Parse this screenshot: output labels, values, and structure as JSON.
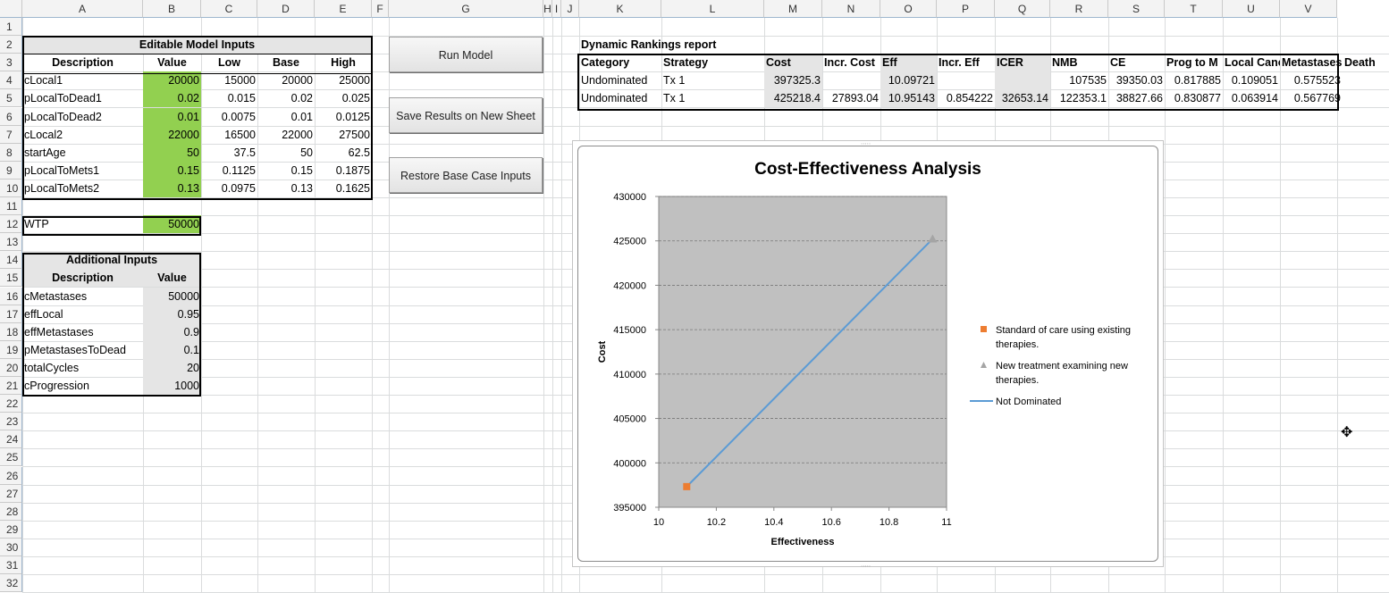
{
  "columns": [
    "A",
    "B",
    "C",
    "D",
    "E",
    "F",
    "G",
    "H",
    "I",
    "J",
    "K",
    "L",
    "M",
    "N",
    "O",
    "P",
    "Q",
    "R",
    "S",
    "T",
    "U",
    "V"
  ],
  "rows": [
    "1",
    "2",
    "3",
    "4",
    "5",
    "6",
    "7",
    "8",
    "9",
    "10",
    "11",
    "12",
    "13",
    "14",
    "15",
    "16",
    "17",
    "18",
    "19",
    "20",
    "21",
    "22",
    "23",
    "24",
    "25",
    "26",
    "27",
    "28",
    "29",
    "30",
    "31",
    "32"
  ],
  "inputs": {
    "title": "Editable Model Inputs",
    "headers": [
      "Description",
      "Value",
      "Low",
      "Base",
      "High"
    ],
    "rows": [
      [
        "cLocal1",
        "20000",
        "15000",
        "20000",
        "25000"
      ],
      [
        "pLocalToDead1",
        "0.02",
        "0.015",
        "0.02",
        "0.025"
      ],
      [
        "pLocalToDead2",
        "0.01",
        "0.0075",
        "0.01",
        "0.0125"
      ],
      [
        "cLocal2",
        "22000",
        "16500",
        "22000",
        "27500"
      ],
      [
        "startAge",
        "50",
        "37.5",
        "50",
        "62.5"
      ],
      [
        "pLocalToMets1",
        "0.15",
        "0.1125",
        "0.15",
        "0.1875"
      ],
      [
        "pLocalToMets2",
        "0.13",
        "0.0975",
        "0.13",
        "0.1625"
      ]
    ]
  },
  "wtp": {
    "label": "WTP",
    "value": "50000"
  },
  "additional": {
    "title": "Additional Inputs",
    "headers": [
      "Description",
      "Value"
    ],
    "rows": [
      [
        "cMetastases",
        "50000"
      ],
      [
        "effLocal",
        "0.95"
      ],
      [
        "effMetastases",
        "0.9"
      ],
      [
        "pMetastasesToDead",
        "0.1"
      ],
      [
        "totalCycles",
        "20"
      ],
      [
        "cProgression",
        "1000"
      ]
    ]
  },
  "buttons": {
    "run": "Run Model",
    "save": "Save Results on New Sheet",
    "restore": "Restore Base Case Inputs"
  },
  "report": {
    "title": "Dynamic Rankings report",
    "headers": [
      "Category",
      "Strategy",
      "Cost",
      "Incr. Cost",
      "Eff",
      "Incr. Eff",
      "ICER",
      "NMB",
      "CE",
      "Prog to M",
      "Local Canc",
      "Metastases",
      "Death"
    ],
    "rows": [
      [
        "Undominated",
        "Tx 1",
        "397325.3",
        "",
        "10.09721",
        "",
        "",
        "107535",
        "39350.03",
        "0.817885",
        "0.109051",
        "0.575523"
      ],
      [
        "Undominated",
        "Tx 1",
        "425218.4",
        "27893.04",
        "10.95143",
        "0.854222",
        "32653.14",
        "122353.1",
        "38827.66",
        "0.830877",
        "0.063914",
        "0.567769"
      ]
    ]
  },
  "colors": {
    "green": "#92d050",
    "plot_bg": "#c0c0c0",
    "line": "#5b9bd5",
    "orange": "#ed7d31",
    "triangle": "#a5a5a5"
  },
  "chart_data": {
    "type": "scatter",
    "title": "Cost-Effectiveness Analysis",
    "xlabel": "Effectiveness",
    "ylabel": "Cost",
    "xlim": [
      10,
      11
    ],
    "ylim": [
      395000,
      430000
    ],
    "xticks": [
      "10",
      "10.2",
      "10.4",
      "10.6",
      "10.8",
      "11"
    ],
    "yticks": [
      "395000",
      "400000",
      "405000",
      "410000",
      "415000",
      "420000",
      "425000",
      "430000"
    ],
    "grid": true,
    "legend_position": "right",
    "series": [
      {
        "name": "Standard of care using existing therapies.",
        "marker": "square",
        "points": [
          [
            10.09721,
            397325.3
          ]
        ]
      },
      {
        "name": "New treatment examining new therapies.",
        "marker": "triangle",
        "points": [
          [
            10.95143,
            425218.4
          ]
        ]
      },
      {
        "name": "Not Dominated",
        "marker": "line",
        "points": [
          [
            10.09721,
            397325.3
          ],
          [
            10.95143,
            425218.4
          ]
        ]
      }
    ]
  }
}
